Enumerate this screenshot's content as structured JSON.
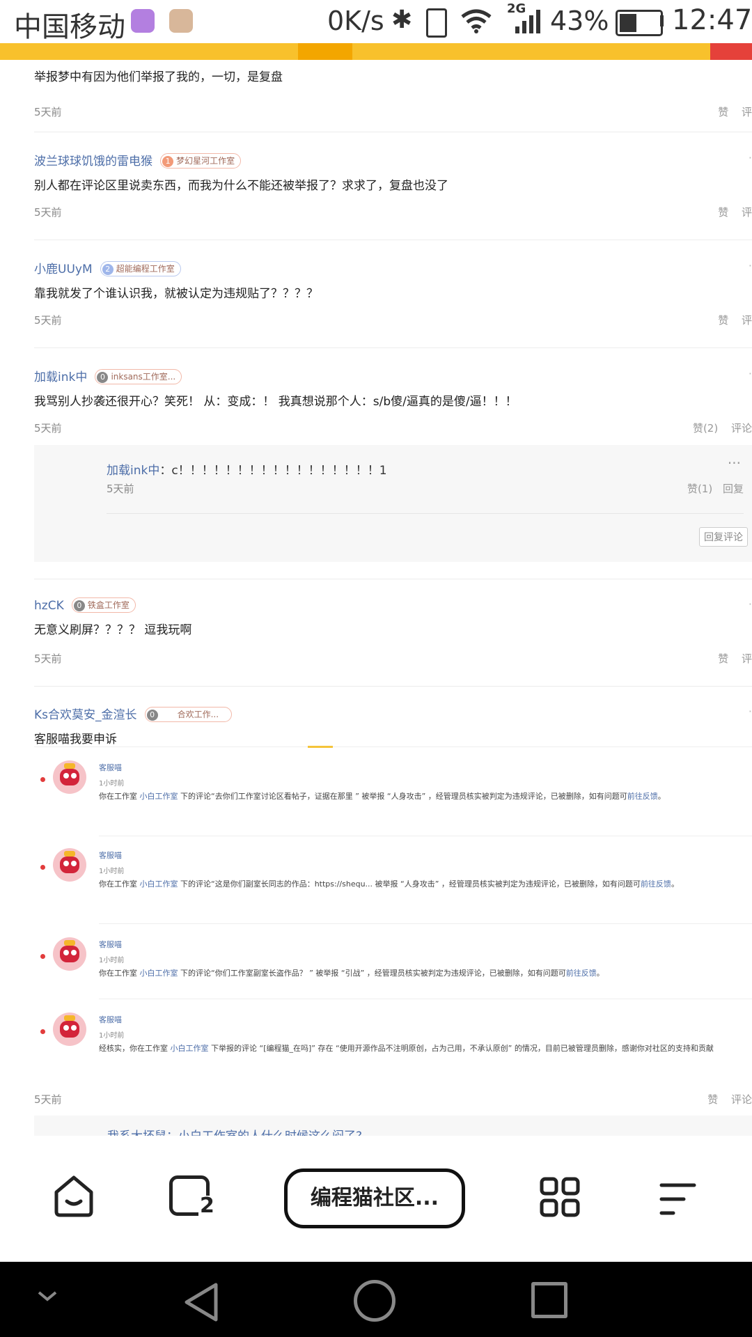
{
  "status_bar": {
    "carrier": "中国移动",
    "net_speed": "0K/s",
    "network_type": "2G",
    "battery": "43%",
    "time": "12:47"
  },
  "comments": [
    {
      "user": "",
      "badge_num": "",
      "badge_label": "",
      "text": "举报梦中有因为他们举报了我的，一切，是复盘",
      "time": "5天前",
      "like": "赞",
      "comment": "评"
    },
    {
      "user": "波兰球球饥饿的雷电猴",
      "badge_num": "1",
      "badge_label": "梦幻星河工作室",
      "text": "别人都在评论区里说卖东西，而我为什么不能还被举报了？求求了，复盘也没了",
      "time": "5天前",
      "like": "赞",
      "comment": "评"
    },
    {
      "user": "小鹿UUyM",
      "badge_num": "2",
      "badge_label": "超能编程工作室",
      "text": "靠我就发了个谁认识我，就被认定为违规贴了？？？？",
      "time": "5天前",
      "like": "赞",
      "comment": "评"
    },
    {
      "user": "加载ink中",
      "badge_num": "0",
      "badge_label": "inksans工作室...",
      "text": "我骂别人抄袭还很开心？笑死！ 从：变成：！ 我真想说那个人：s/b傻/逼真的是傻/逼！！！",
      "time": "5天前",
      "like": "赞(2)",
      "comment": "评论"
    },
    {
      "user": "hzCK",
      "badge_num": "0",
      "badge_label": "铁盒工作室",
      "text": "无意义刷屏？？？？ 逗我玩啊",
      "time": "5天前",
      "like": "赞",
      "comment": "评"
    },
    {
      "user": "Ks合欢莫安_金渲长",
      "badge_num": "0",
      "badge_label": "合欢工作...",
      "text": "客服喵我要申诉",
      "time": "5天前",
      "like": "赞",
      "comment": "评论"
    }
  ],
  "reply": {
    "user": "加载ink中",
    "text": "：c！！！！！！！！！！！！！！！！！1",
    "time": "5天前",
    "like": "赞(1)",
    "reply_label": "回复",
    "reply_comment_button": "回复评论",
    "more": "···"
  },
  "notifications": [
    {
      "sender": "客服喵",
      "time": "1小时前",
      "pre": "你在工作室 ",
      "studio": "小白工作室",
      "mid": " 下的评论“去你们工作室讨论区看帖子，证据在那里 ” 被举报 “人身攻击” ，经管理员核实被判定为违规评论，已被删除，如有问题可",
      "link": "前往反馈",
      "post": "。"
    },
    {
      "sender": "客服喵",
      "time": "1小时前",
      "pre": "你在工作室 ",
      "studio": "小白工作室",
      "mid": " 下的评论“这是你们副室长同志的作品：https://shequ... 被举报 “人身攻击” ，经管理员核实被判定为违规评论，已被删除，如有问题可",
      "link": "前往反馈",
      "post": "。"
    },
    {
      "sender": "客服喵",
      "time": "1小时前",
      "pre": "你在工作室 ",
      "studio": "小白工作室",
      "mid": " 下的评论“你们工作室副室长盗作品？ ” 被举报 “引战” ，经管理员核实被判定为违规评论，已被删除，如有问题可",
      "link": "前往反馈",
      "post": "。"
    },
    {
      "sender": "客服喵",
      "time": "1小时前",
      "pre": "经核实，你在工作室 ",
      "studio": "小白工作室",
      "mid": " 下举报的评论 “[编程猫_在吗]” 存在 “使用开源作品不注明原创，占为己用，不承认原创” 的情况，目前已被管理员删除，感谢你对社区的支持和贡献",
      "link": "",
      "post": ""
    }
  ],
  "cut_off_reply": "我系大坏鼠：小白工作室的人什么时候这么闷了?",
  "bottom_bar": {
    "tab_count": "2",
    "page_title": "编程猫社区..."
  },
  "colors": {
    "topbar_yellow": "#f8c12c",
    "link_blue": "#4d6ea8",
    "unread_dot": "#e23c3c"
  }
}
